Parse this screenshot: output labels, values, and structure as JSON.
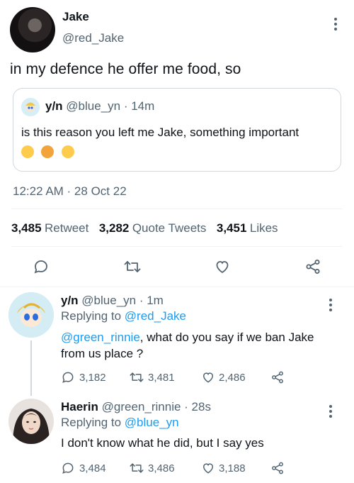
{
  "main_tweet": {
    "name": "Jake",
    "handle": "@red_Jake",
    "text": "in my defence he offer me food, so",
    "quote": {
      "name": "y/n",
      "handle": "@blue_yn",
      "time": "· 14m",
      "text": "is this reason you left me Jake, something important"
    },
    "timestamp": "12:22 AM · 28 Oct 22",
    "stats": {
      "retweets": "3,485",
      "retweets_label": "Retweet",
      "quotes": "3,282",
      "quotes_label": "Quote Tweets",
      "likes": "3,451",
      "likes_label": "Likes"
    }
  },
  "replies": [
    {
      "name": "y/n",
      "handle": "@blue_yn",
      "time": "· 1m",
      "replying_prefix": "Replying to",
      "replying_to": "@red_Jake",
      "mention": "@green_rinnie",
      "text": ", what do you say if we ban Jake from us place ?",
      "replies": "3,182",
      "retweets": "3,481",
      "likes": "2,486"
    },
    {
      "name": "Haerin",
      "handle": "@green_rinnie",
      "time": "· 28s",
      "replying_prefix": "Replying to",
      "replying_to": "@blue_yn",
      "text": "I don't know what he did, but I say yes",
      "replies": "3,484",
      "retweets": "3,486",
      "likes": "3,188"
    }
  ],
  "icons": {
    "reply": "reply-icon",
    "retweet": "retweet-icon",
    "like": "heart-icon",
    "share": "share-icon",
    "more": "more-icon"
  },
  "colors": {
    "accent": "#1d9bf0",
    "secondary_text": "#536471",
    "border": "#cfd9de"
  }
}
